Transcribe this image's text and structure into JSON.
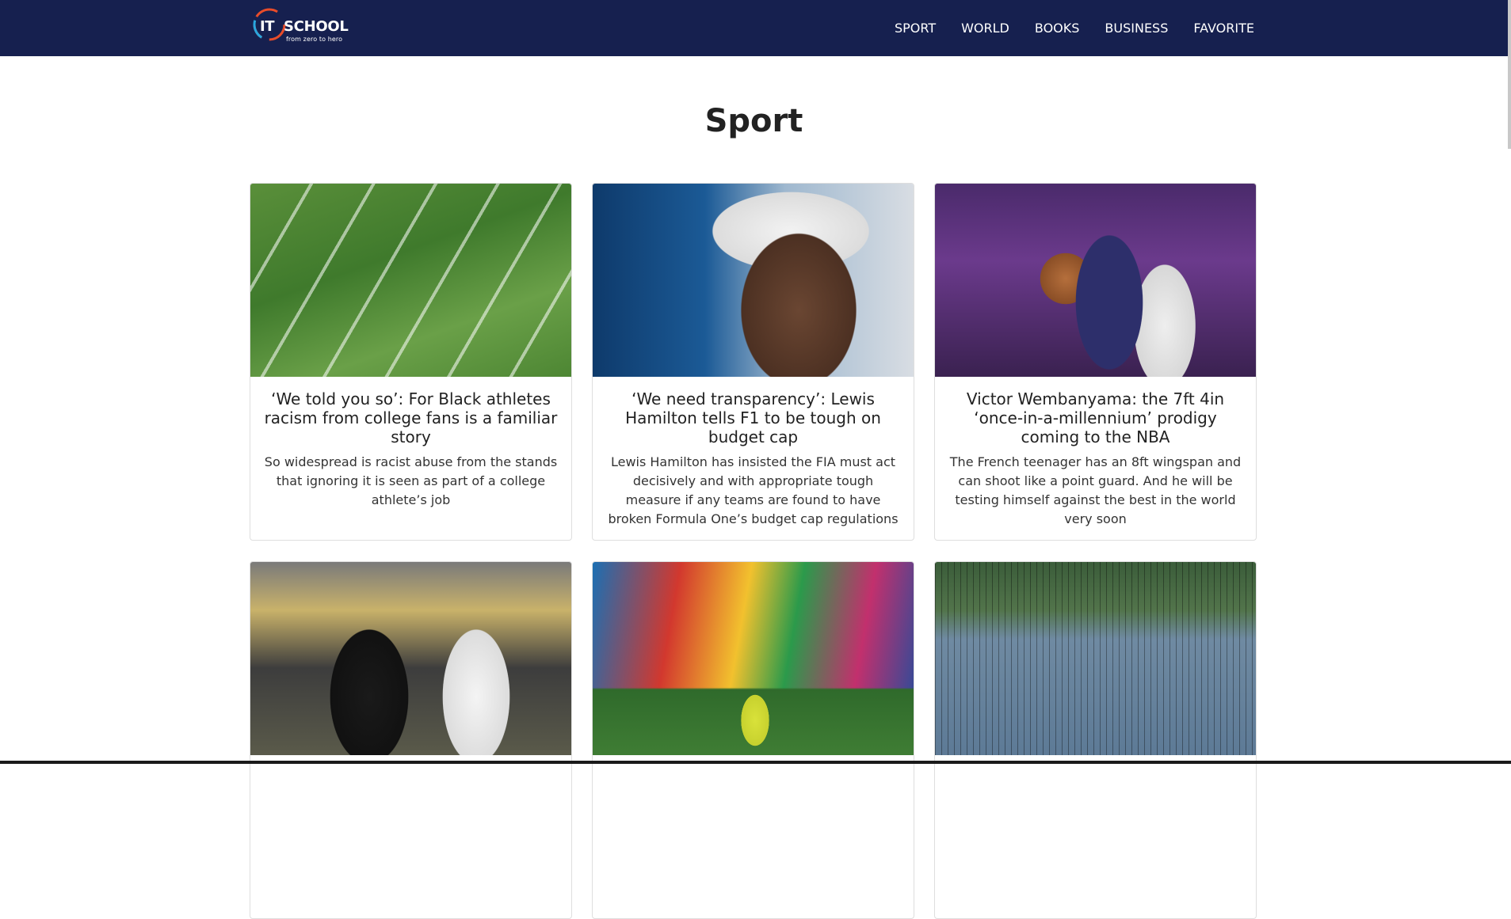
{
  "brand": {
    "it": "IT",
    "name": "SCHOOL",
    "tagline": "from zero to hero"
  },
  "nav": {
    "items": [
      "SPORT",
      "WORLD",
      "BOOKS",
      "BUSINESS",
      "FAVORITE"
    ]
  },
  "page": {
    "title": "Sport"
  },
  "cards": [
    {
      "image": "american-football-field-photo",
      "title": "‘We told you so’: For Black athletes racism from college fans is a familiar story",
      "text": "So widespread is racist abuse from the stands that ignoring it is seen as part of a college athlete’s job"
    },
    {
      "image": "lewis-hamilton-portrait-photo",
      "title": "‘We need transparency’: Lewis Hamilton tells F1 to be tough on budget cap",
      "text": "Lewis Hamilton has insisted the FIA must act decisively and with appropriate tough measure if any teams are found to have broken Formula One’s budget cap regulations"
    },
    {
      "image": "victor-wembanyama-basketball-photo",
      "title": "Victor Wembanyama: the 7ft 4in ‘once-in-a-millennium’ prodigy coming to the NBA",
      "text": "The French teenager has an 8ft wingspan and can shoot like a point guard. And he will be testing himself against the best in the world very soon"
    },
    {
      "image": "nfl-players-stadium-photo",
      "title": "",
      "text": ""
    },
    {
      "image": "rugby-teams-trophy-photo",
      "title": "",
      "text": ""
    },
    {
      "image": "pickleball-court-photo",
      "title": "",
      "text": ""
    }
  ]
}
